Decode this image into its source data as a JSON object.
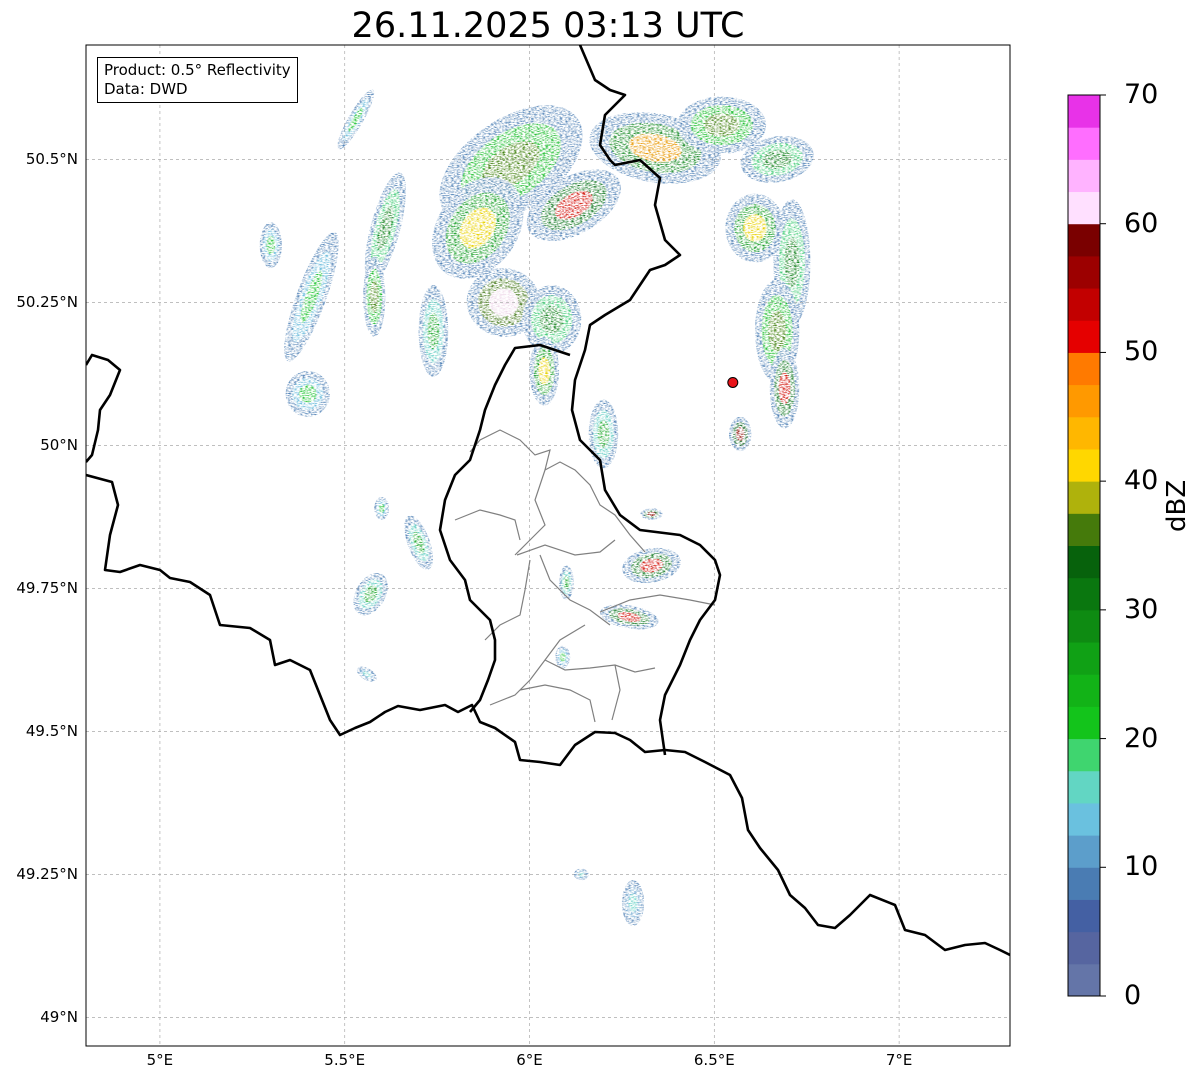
{
  "title": "26.11.2025 03:13 UTC",
  "info": {
    "product": "Product: 0.5° Reflectivity",
    "data": "Data: DWD"
  },
  "map": {
    "extent": {
      "lon": [
        4.8,
        7.3
      ],
      "lat": [
        48.95,
        50.7
      ]
    },
    "grid": true,
    "x_ticks": [
      {
        "value": 5.0,
        "label": "5°E"
      },
      {
        "value": 5.5,
        "label": "5.5°E"
      },
      {
        "value": 6.0,
        "label": "6°E"
      },
      {
        "value": 6.5,
        "label": "6.5°E"
      },
      {
        "value": 7.0,
        "label": "7°E"
      }
    ],
    "y_ticks": [
      {
        "value": 50.5,
        "label": "50.5°N"
      },
      {
        "value": 50.25,
        "label": "50.25°N"
      },
      {
        "value": 50.0,
        "label": "50°N"
      },
      {
        "value": 49.75,
        "label": "49.75°N"
      },
      {
        "value": 49.5,
        "label": "49.5°N"
      },
      {
        "value": 49.25,
        "label": "49.25°N"
      },
      {
        "value": 49.0,
        "label": "49°N"
      }
    ],
    "radar_site": {
      "lon": 6.55,
      "lat": 50.11,
      "color": "#e8141a"
    },
    "borders_color": "#000000",
    "district_color": "#808080"
  },
  "colorbar": {
    "label": "dBZ",
    "min": 0,
    "max": 70,
    "tick_labels": [
      "0",
      "10",
      "20",
      "30",
      "40",
      "50",
      "60",
      "70"
    ],
    "colors": [
      "#6475a8",
      "#5665a0",
      "#4460a3",
      "#4a7cb3",
      "#5c9ecb",
      "#6ac1df",
      "#62d6c3",
      "#3fd56f",
      "#13c41b",
      "#12b317",
      "#10a115",
      "#0e8b12",
      "#0a770f",
      "#07620c",
      "#457a0b",
      "#afb20c",
      "#ffd700",
      "#ffb700",
      "#ff9900",
      "#ff7a00",
      "#e50000",
      "#c20000",
      "#9c0000",
      "#7a0000",
      "#ffe0ff",
      "#ffb3ff",
      "#ff6eff",
      "#e832e8"
    ]
  },
  "echoes": [
    {
      "lon": 5.95,
      "lat": 50.49,
      "rx": 0.22,
      "ry": 0.08,
      "rot": -35,
      "level": 14
    },
    {
      "lon": 5.86,
      "lat": 50.38,
      "rx": 0.15,
      "ry": 0.07,
      "rot": -55,
      "level": 16
    },
    {
      "lon": 5.93,
      "lat": 50.25,
      "rx": 0.1,
      "ry": 0.06,
      "rot": 10,
      "level": 24
    },
    {
      "lon": 6.06,
      "lat": 50.22,
      "rx": 0.08,
      "ry": 0.06,
      "rot": 0,
      "level": 12
    },
    {
      "lon": 6.12,
      "lat": 50.42,
      "rx": 0.14,
      "ry": 0.05,
      "rot": -30,
      "level": 20
    },
    {
      "lon": 6.34,
      "lat": 50.52,
      "rx": 0.18,
      "ry": 0.06,
      "rot": 10,
      "level": 18
    },
    {
      "lon": 6.52,
      "lat": 50.56,
      "rx": 0.12,
      "ry": 0.05,
      "rot": 0,
      "level": 14
    },
    {
      "lon": 6.67,
      "lat": 50.5,
      "rx": 0.1,
      "ry": 0.04,
      "rot": -10,
      "level": 12
    },
    {
      "lon": 6.61,
      "lat": 50.38,
      "rx": 0.08,
      "ry": 0.06,
      "rot": 0,
      "level": 16
    },
    {
      "lon": 6.71,
      "lat": 50.32,
      "rx": 0.05,
      "ry": 0.11,
      "rot": 0,
      "level": 12
    },
    {
      "lon": 6.67,
      "lat": 50.2,
      "rx": 0.06,
      "ry": 0.09,
      "rot": 0,
      "level": 14
    },
    {
      "lon": 6.69,
      "lat": 50.1,
      "rx": 0.04,
      "ry": 0.07,
      "rot": 0,
      "level": 20
    },
    {
      "lon": 6.57,
      "lat": 50.02,
      "rx": 0.03,
      "ry": 0.03,
      "rot": 0,
      "level": 22
    },
    {
      "lon": 5.61,
      "lat": 50.38,
      "rx": 0.04,
      "ry": 0.1,
      "rot": 15,
      "level": 12
    },
    {
      "lon": 5.41,
      "lat": 50.26,
      "rx": 0.04,
      "ry": 0.12,
      "rot": 20,
      "level": 8
    },
    {
      "lon": 5.58,
      "lat": 50.26,
      "rx": 0.03,
      "ry": 0.07,
      "rot": 0,
      "level": 14
    },
    {
      "lon": 5.74,
      "lat": 50.2,
      "rx": 0.04,
      "ry": 0.08,
      "rot": 0,
      "level": 10
    },
    {
      "lon": 5.4,
      "lat": 50.09,
      "rx": 0.06,
      "ry": 0.04,
      "rot": 0,
      "level": 8
    },
    {
      "lon": 5.53,
      "lat": 50.57,
      "rx": 0.02,
      "ry": 0.06,
      "rot": 30,
      "level": 8
    },
    {
      "lon": 5.3,
      "lat": 50.35,
      "rx": 0.03,
      "ry": 0.04,
      "rot": 0,
      "level": 8
    },
    {
      "lon": 6.2,
      "lat": 50.02,
      "rx": 0.04,
      "ry": 0.06,
      "rot": 0,
      "level": 10
    },
    {
      "lon": 6.04,
      "lat": 50.13,
      "rx": 0.04,
      "ry": 0.06,
      "rot": 0,
      "level": 16
    },
    {
      "lon": 6.33,
      "lat": 49.88,
      "rx": 0.03,
      "ry": 0.01,
      "rot": 0,
      "level": 22
    },
    {
      "lon": 6.33,
      "lat": 49.79,
      "rx": 0.08,
      "ry": 0.03,
      "rot": -10,
      "level": 20
    },
    {
      "lon": 6.27,
      "lat": 49.7,
      "rx": 0.08,
      "ry": 0.02,
      "rot": 10,
      "level": 20
    },
    {
      "lon": 5.7,
      "lat": 49.83,
      "rx": 0.03,
      "ry": 0.05,
      "rot": -20,
      "level": 10
    },
    {
      "lon": 5.57,
      "lat": 49.74,
      "rx": 0.04,
      "ry": 0.04,
      "rot": 30,
      "level": 10
    },
    {
      "lon": 5.6,
      "lat": 49.89,
      "rx": 0.02,
      "ry": 0.02,
      "rot": 0,
      "level": 8
    },
    {
      "lon": 5.56,
      "lat": 49.6,
      "rx": 0.03,
      "ry": 0.01,
      "rot": 30,
      "level": 6
    },
    {
      "lon": 6.1,
      "lat": 49.76,
      "rx": 0.02,
      "ry": 0.03,
      "rot": 0,
      "level": 10
    },
    {
      "lon": 6.28,
      "lat": 49.2,
      "rx": 0.03,
      "ry": 0.04,
      "rot": 0,
      "level": 6
    },
    {
      "lon": 6.14,
      "lat": 49.25,
      "rx": 0.02,
      "ry": 0.01,
      "rot": 0,
      "level": 6
    },
    {
      "lon": 6.09,
      "lat": 49.63,
      "rx": 0.02,
      "ry": 0.02,
      "rot": 0,
      "level": 8
    }
  ]
}
